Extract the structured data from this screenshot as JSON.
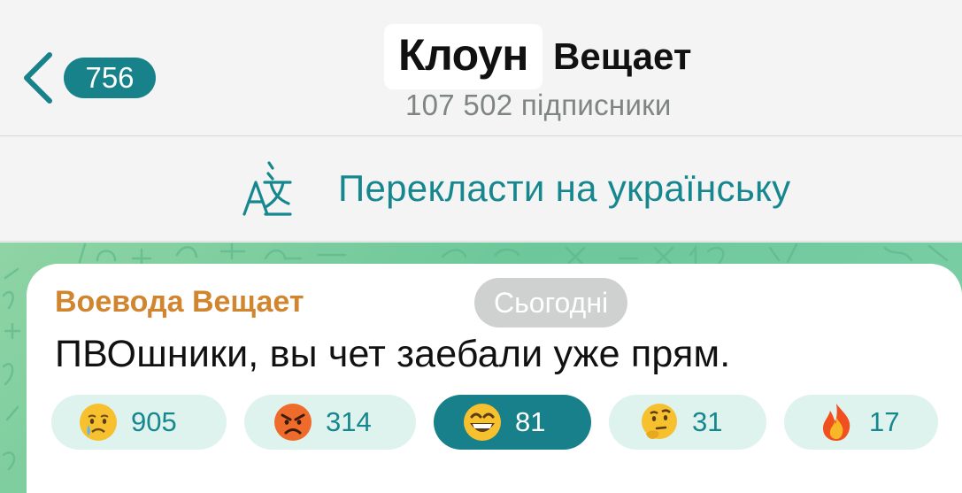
{
  "header": {
    "back_count": "756",
    "title_highlight": "Клоун",
    "title_rest": "Вещает",
    "subtitle": "107 502 підписники"
  },
  "translate": {
    "label": "Перекласти на українську",
    "icon": "translate-icon"
  },
  "message": {
    "sender": "Воевода Вещает",
    "date": "Сьогодні",
    "text": "ПВОшники, вы чет заебали уже прям."
  },
  "reactions": [
    {
      "emoji": "crying-face",
      "count": "905",
      "active": false
    },
    {
      "emoji": "angry-face",
      "count": "314",
      "active": false
    },
    {
      "emoji": "grinning-face",
      "count": "81",
      "active": true
    },
    {
      "emoji": "thinking-face",
      "count": "31",
      "active": false
    },
    {
      "emoji": "fire",
      "count": "17",
      "active": false
    }
  ],
  "colors": {
    "accent": "#17828a",
    "sender": "#d1852f",
    "chat_bg": "#7fd0a8",
    "reaction_bg": "#dff3ee"
  }
}
